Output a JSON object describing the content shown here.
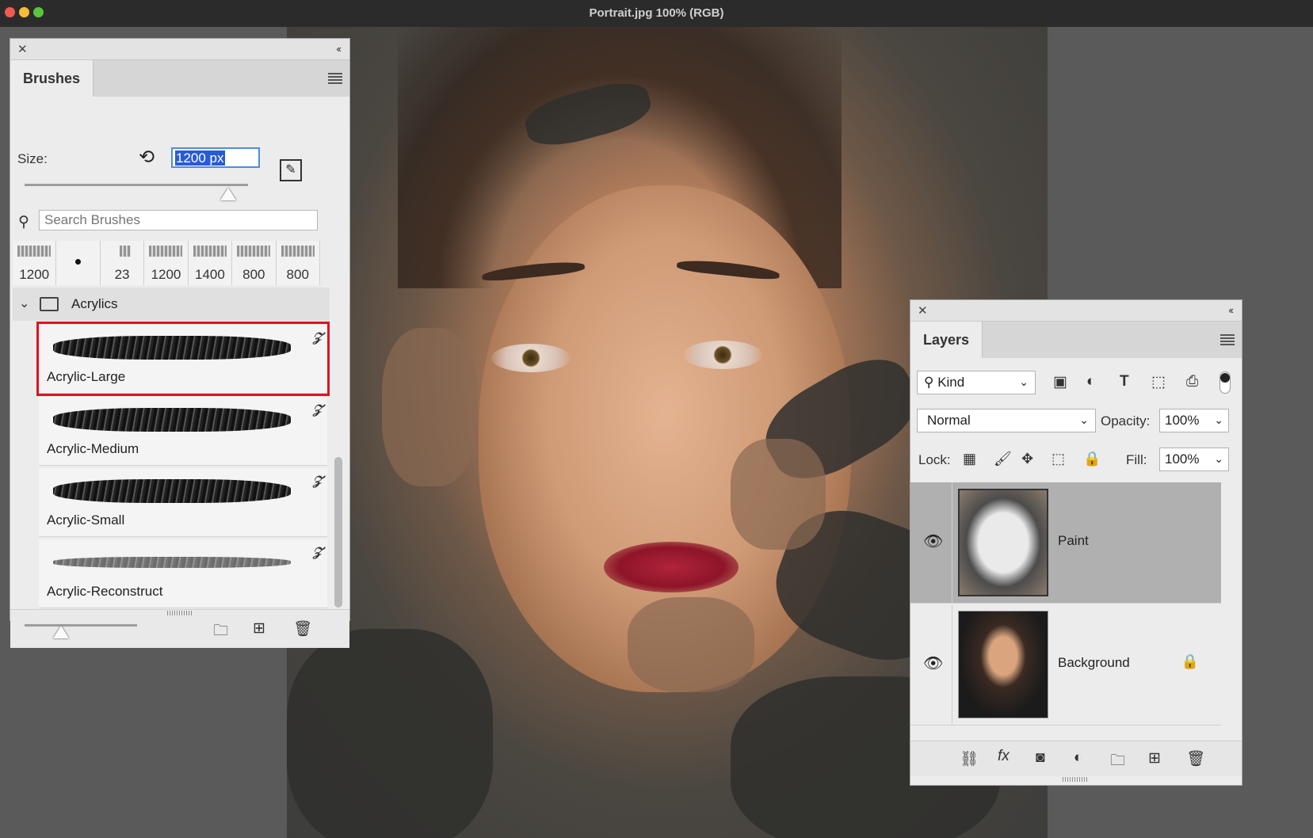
{
  "window": {
    "title": "Portrait.jpg 100% (RGB)"
  },
  "brushes_panel": {
    "tab": "Brushes",
    "size_label": "Size:",
    "size_value": "1200 px",
    "search_placeholder": "Search Brushes",
    "presets": [
      "1200",
      "",
      "23",
      "1200",
      "1400",
      "800",
      "800"
    ],
    "group": "Acrylics",
    "items": [
      "Acrylic-Large",
      "Acrylic-Medium",
      "Acrylic-Small",
      "Acrylic-Reconstruct"
    ],
    "selected": "Acrylic-Large"
  },
  "layers_panel": {
    "tab": "Layers",
    "filter_kind": "Kind",
    "blend_mode": "Normal",
    "opacity_label": "Opacity:",
    "opacity_value": "100%",
    "lock_label": "Lock:",
    "fill_label": "Fill:",
    "fill_value": "100%",
    "layers": [
      {
        "name": "Paint",
        "selected": true
      },
      {
        "name": "Background",
        "locked": true
      }
    ],
    "bottom_icons": [
      "link-icon",
      "fx-icon",
      "mask-icon",
      "adjustment-icon",
      "folder-icon",
      "new-layer-icon",
      "trash-icon"
    ]
  }
}
